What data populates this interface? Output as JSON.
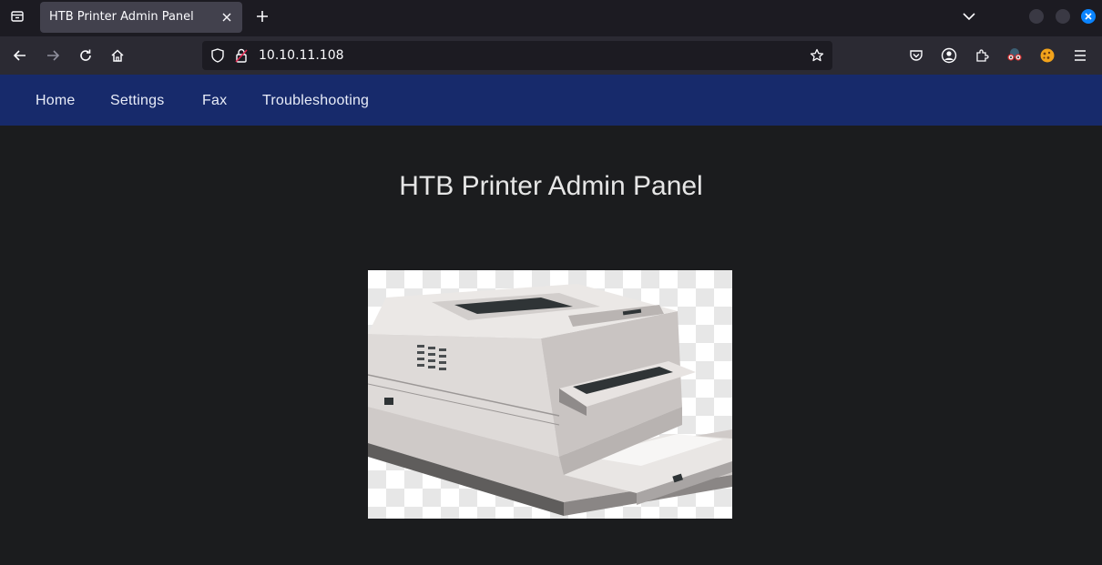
{
  "browser": {
    "tab_title": "HTB Printer Admin Panel",
    "url": "10.10.11.108"
  },
  "site_nav": {
    "items": [
      "Home",
      "Settings",
      "Fax",
      "Troubleshooting"
    ]
  },
  "main": {
    "title": "HTB Printer Admin Panel"
  },
  "colors": {
    "site_nav_bg": "#172a6b",
    "page_bg": "#1b1c1e",
    "close_button": "#0a84ff"
  },
  "icons": {
    "tab_list": "tab-list-icon",
    "printer": "printer-image"
  }
}
